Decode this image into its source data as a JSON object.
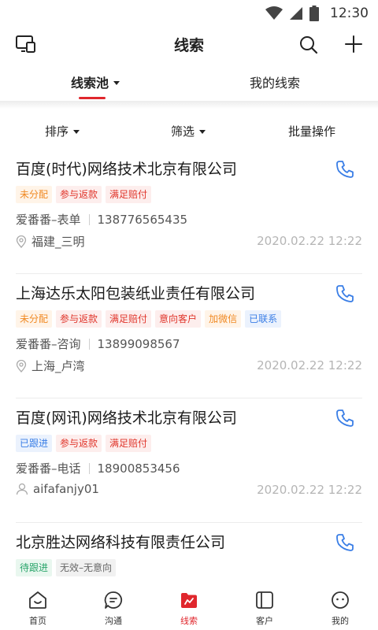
{
  "status_bar": {
    "time": "12:30"
  },
  "header": {
    "title": "线索"
  },
  "top_tabs": [
    {
      "label": "线索池",
      "active": true
    },
    {
      "label": "我的线索",
      "active": false
    }
  ],
  "filters": {
    "sort": "排序",
    "screen": "筛选",
    "batch": "批量操作"
  },
  "cards": [
    {
      "title": "百度(时代)网络技术北京有限公司",
      "tags": [
        {
          "text": "未分配",
          "color": "orange"
        },
        {
          "text": "参与返款",
          "color": "red"
        },
        {
          "text": "满足赔付",
          "color": "red"
        }
      ],
      "source": "爱番番–表单",
      "phone": "138776565435",
      "meta_type": "location",
      "meta": "福建_三明",
      "time": "2020.02.22 12:22"
    },
    {
      "title": "上海达乐太阳包装纸业责任有限公司",
      "tags": [
        {
          "text": "未分配",
          "color": "orange"
        },
        {
          "text": "参与返款",
          "color": "red"
        },
        {
          "text": "满足赔付",
          "color": "red"
        },
        {
          "text": "意向客户",
          "color": "red"
        },
        {
          "text": "加微信",
          "color": "orange"
        },
        {
          "text": "已联系",
          "color": "blue"
        }
      ],
      "source": "爱番番–咨询",
      "phone": "13899098567",
      "meta_type": "location",
      "meta": "上海_卢湾",
      "time": "2020.02.22 12:22"
    },
    {
      "title": "百度(网讯)网络技术北京有限公司",
      "tags": [
        {
          "text": "已跟进",
          "color": "blue"
        },
        {
          "text": "参与返款",
          "color": "red"
        },
        {
          "text": "满足赔付",
          "color": "red"
        }
      ],
      "source": "爱番番–电话",
      "phone": "18900853456",
      "meta_type": "user",
      "meta": "aifafanjy01",
      "time": "2020.02.22 12:22"
    },
    {
      "title": "北京胜达网络科技有限责任公司",
      "tags": [
        {
          "text": "待跟进",
          "color": "green"
        },
        {
          "text": "无效–无意向",
          "color": "gray"
        }
      ]
    }
  ],
  "bottom_nav": [
    {
      "label": "首页",
      "icon": "home-icon",
      "active": false
    },
    {
      "label": "沟通",
      "icon": "chat-icon",
      "active": false
    },
    {
      "label": "线索",
      "icon": "leads-icon",
      "active": true
    },
    {
      "label": "客户",
      "icon": "customer-icon",
      "active": false
    },
    {
      "label": "我的",
      "icon": "profile-icon",
      "active": false
    }
  ],
  "colors": {
    "accent": "#e0272d",
    "link_blue": "#3a7ee6"
  }
}
